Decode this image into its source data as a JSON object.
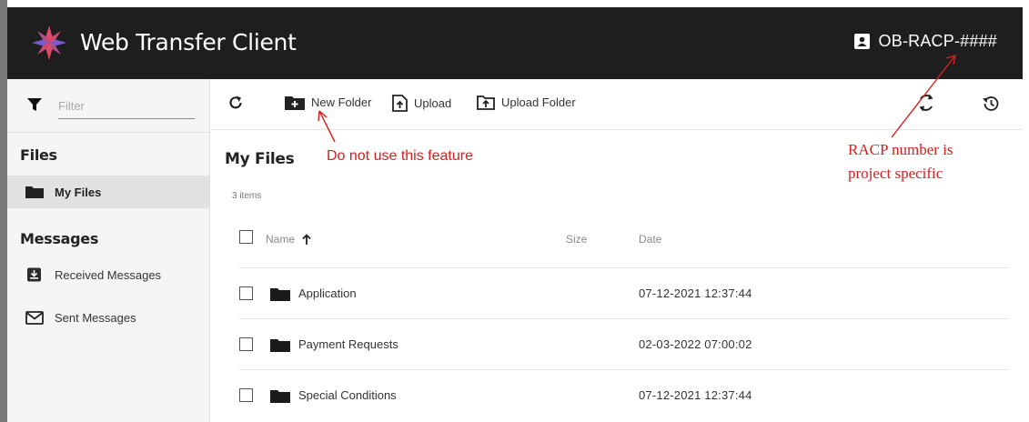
{
  "header": {
    "app_title": "Web Transfer Client",
    "user_name": "OB-RACP-",
    "user_suffix": "####"
  },
  "sidebar": {
    "filter_placeholder": "Filter",
    "files_heading": "Files",
    "files_items": [
      {
        "label": "My Files",
        "icon": "folder-icon",
        "active": true
      }
    ],
    "messages_heading": "Messages",
    "messages_items": [
      {
        "label": "Received Messages",
        "icon": "inbox-download-icon"
      },
      {
        "label": "Sent Messages",
        "icon": "envelope-icon"
      }
    ]
  },
  "toolbar": {
    "new_folder_label": "New Folder",
    "upload_label": "Upload",
    "upload_folder_label": "Upload Folder"
  },
  "main": {
    "title": "My Files",
    "item_count": "3 items",
    "columns": {
      "name": "Name",
      "size": "Size",
      "date": "Date"
    },
    "rows": [
      {
        "name": "Application",
        "size": "",
        "date": "07-12-2021 12:37:44"
      },
      {
        "name": "Payment Requests",
        "size": "",
        "date": "02-03-2022 07:00:02"
      },
      {
        "name": "Special Conditions",
        "size": "",
        "date": "07-12-2021 12:37:44"
      }
    ]
  },
  "annotations": {
    "new_folder_note": "Do not use this feature",
    "racp_note_line1": "RACP number is",
    "racp_note_line2": "project specific"
  },
  "colors": {
    "header_bg": "#1e1e1e",
    "sidebar_bg": "#f5f5f5",
    "active_item_bg": "#e2e2e2",
    "annotation_red": "#d42020",
    "logo_red": "#e04a68",
    "logo_purple": "#7a5ad0"
  }
}
